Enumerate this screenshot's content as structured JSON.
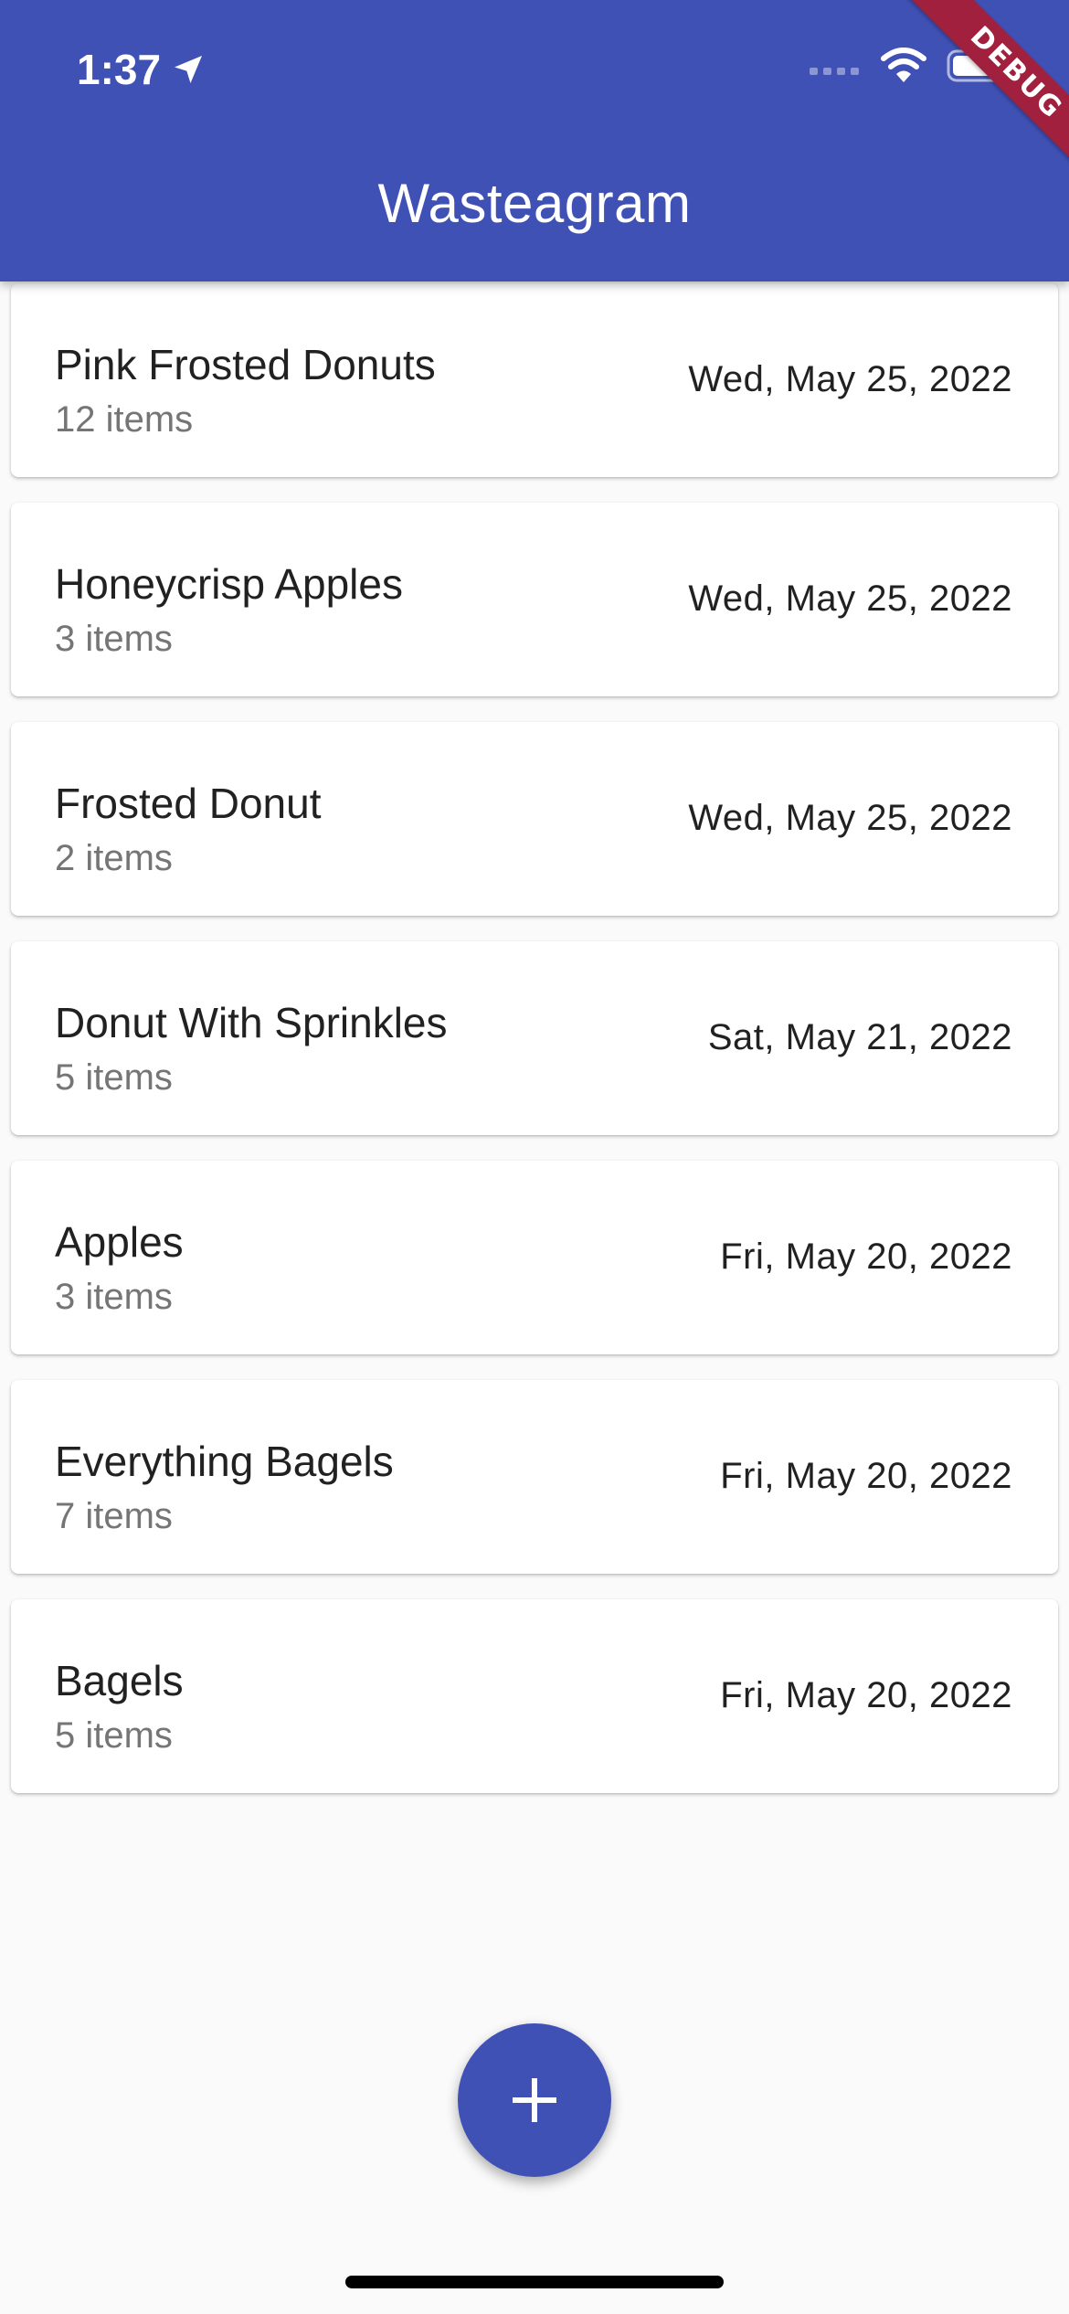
{
  "status_bar": {
    "time": "1:37",
    "location-icon": "location-arrow-icon",
    "signal-icon": "cellular-signal-icon",
    "wifi-icon": "wifi-icon",
    "battery-icon": "battery-icon"
  },
  "debug_banner": "DEBUG",
  "app_bar": {
    "title": "Wasteagram"
  },
  "entries": [
    {
      "title": "Pink Frosted Donuts",
      "count": "12 items",
      "date": "Wed, May 25, 2022"
    },
    {
      "title": "Honeycrisp Apples",
      "count": "3 items",
      "date": "Wed, May 25, 2022"
    },
    {
      "title": "Frosted Donut",
      "count": "2 items",
      "date": "Wed, May 25, 2022"
    },
    {
      "title": "Donut With Sprinkles",
      "count": "5 items",
      "date": "Sat, May 21, 2022"
    },
    {
      "title": "Apples",
      "count": "3 items",
      "date": "Fri, May 20, 2022"
    },
    {
      "title": "Everything Bagels",
      "count": "7 items",
      "date": "Fri, May 20, 2022"
    },
    {
      "title": "Bagels",
      "count": "5 items",
      "date": "Fri, May 20, 2022"
    }
  ],
  "fab": {
    "icon": "plus-icon"
  },
  "colors": {
    "primary": "#3f51b5",
    "background": "#fafafa",
    "card": "#ffffff",
    "title_text": "#212121",
    "subtitle_text": "#757575",
    "debug_banner": "#a0203e"
  }
}
